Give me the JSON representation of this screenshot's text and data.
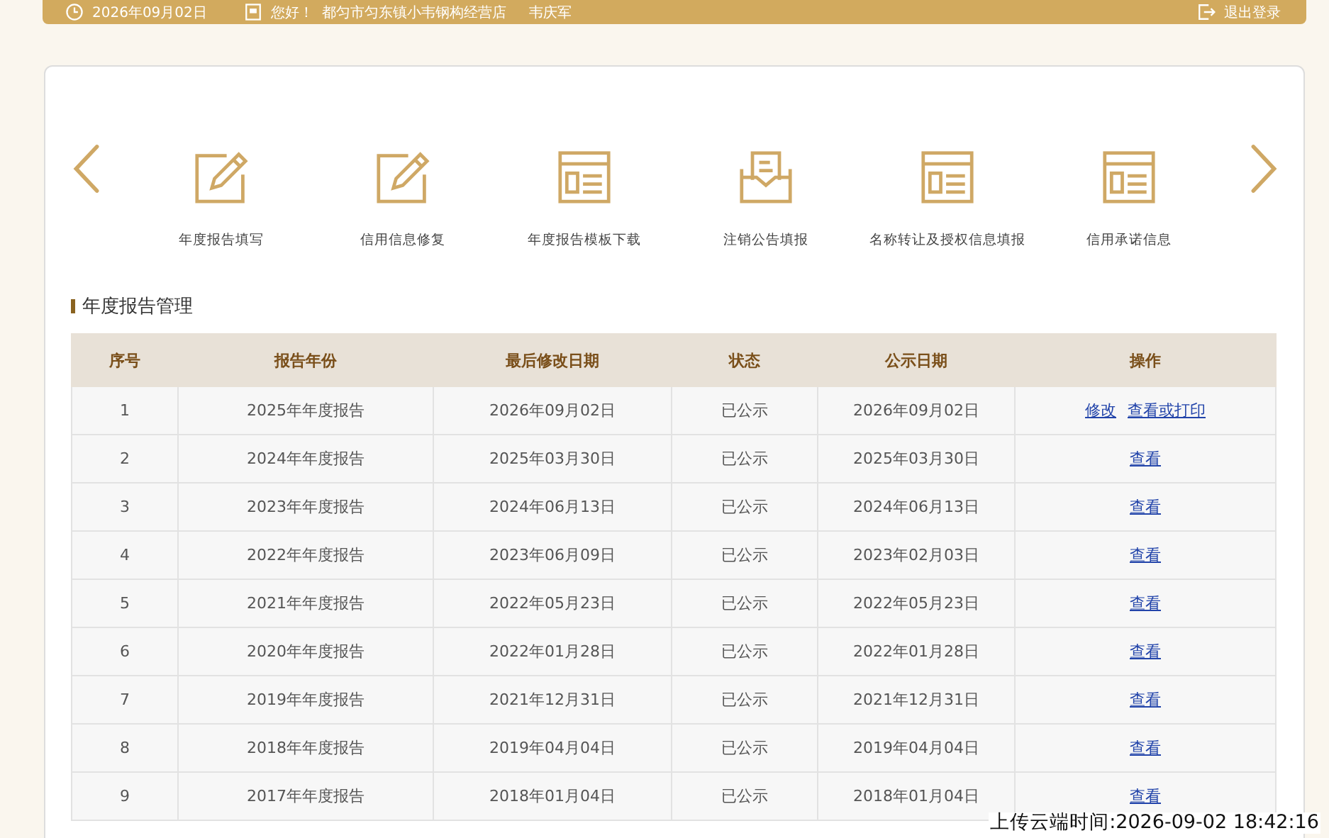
{
  "top_bar": {
    "date": "2026年09月02日",
    "greeting": "您好！",
    "company": "都匀市匀东镇小韦钢构经营店",
    "user": "韦庆军",
    "logout": "退出登录"
  },
  "shortcuts": [
    {
      "label": "年度报告填写",
      "kind": "edit"
    },
    {
      "label": "信用信息修复",
      "kind": "edit"
    },
    {
      "label": "年度报告模板下载",
      "kind": "template"
    },
    {
      "label": "注销公告填报",
      "kind": "inbox"
    },
    {
      "label": "名称转让及授权信息填报",
      "kind": "template"
    },
    {
      "label": "信用承诺信息",
      "kind": "template"
    }
  ],
  "section_title": "年度报告管理",
  "table": {
    "columns": [
      "序号",
      "报告年份",
      "最后修改日期",
      "状态",
      "公示日期",
      "操作"
    ],
    "rows": [
      {
        "cells": [
          "1",
          "2025年年度报告",
          "2026年09月02日",
          "已公示",
          "2026年09月02日"
        ],
        "actions": [
          "修改",
          "查看或打印"
        ]
      },
      {
        "cells": [
          "2",
          "2024年年度报告",
          "2025年03月30日",
          "已公示",
          "2025年03月30日"
        ],
        "actions": [
          "查看"
        ]
      },
      {
        "cells": [
          "3",
          "2023年年度报告",
          "2024年06月13日",
          "已公示",
          "2024年06月13日"
        ],
        "actions": [
          "查看"
        ]
      },
      {
        "cells": [
          "4",
          "2022年年度报告",
          "2023年06月09日",
          "已公示",
          "2023年02月03日"
        ],
        "actions": [
          "查看"
        ]
      },
      {
        "cells": [
          "5",
          "2021年年度报告",
          "2022年05月23日",
          "已公示",
          "2022年05月23日"
        ],
        "actions": [
          "查看"
        ]
      },
      {
        "cells": [
          "6",
          "2020年年度报告",
          "2022年01月28日",
          "已公示",
          "2022年01月28日"
        ],
        "actions": [
          "查看"
        ]
      },
      {
        "cells": [
          "7",
          "2019年年度报告",
          "2021年12月31日",
          "已公示",
          "2021年12月31日"
        ],
        "actions": [
          "查看"
        ]
      },
      {
        "cells": [
          "8",
          "2018年年度报告",
          "2019年04月04日",
          "已公示",
          "2019年04月04日"
        ],
        "actions": [
          "查看"
        ]
      },
      {
        "cells": [
          "9",
          "2017年年度报告",
          "2018年01月04日",
          "已公示",
          "2018年01月04日"
        ],
        "actions": [
          "查看"
        ]
      }
    ]
  },
  "upload_stamp": "上传云端时间:2026-09-02 18:42:16"
}
